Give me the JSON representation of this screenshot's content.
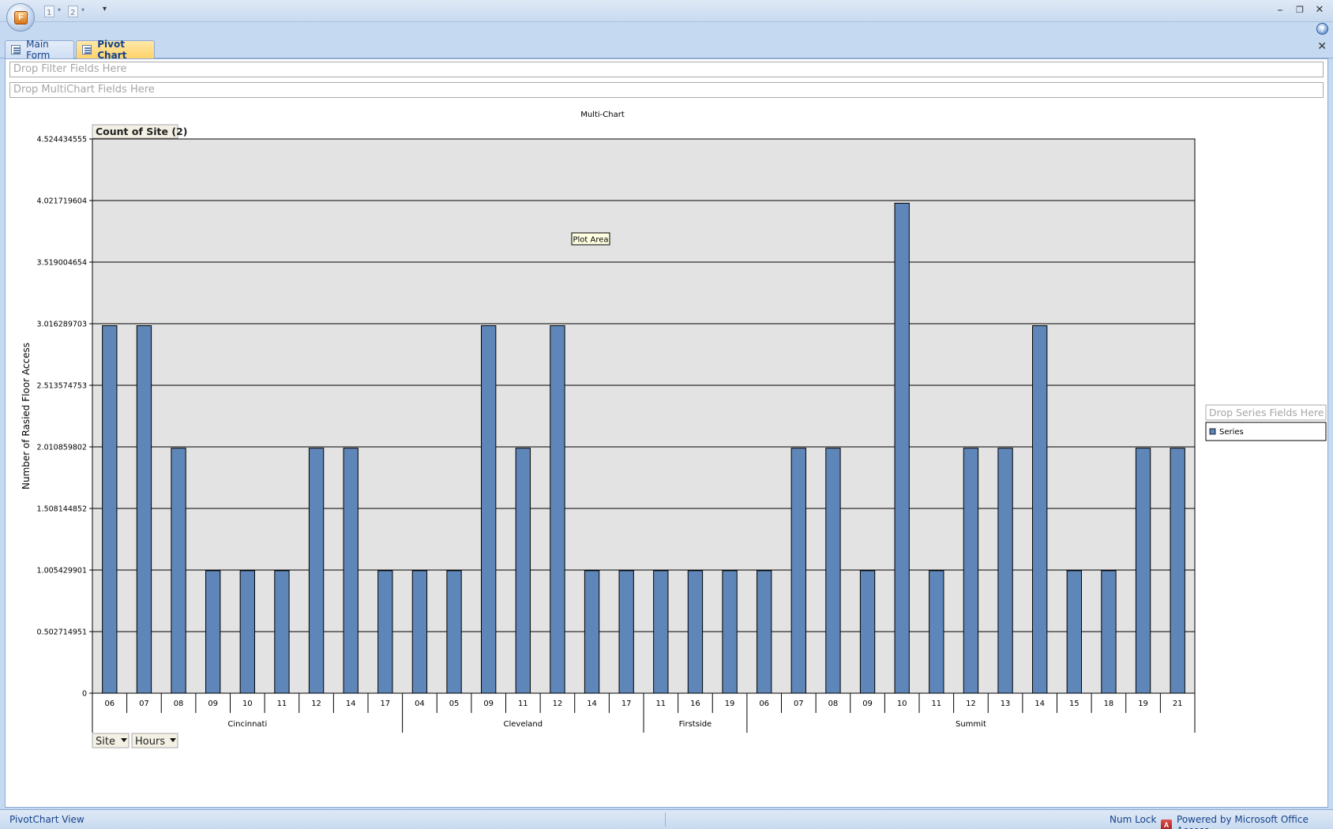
{
  "window": {
    "office_button_letter": "F",
    "qat_items": [
      "1",
      "2"
    ],
    "minimize": "–",
    "restore": "❐",
    "close": "✕",
    "help": "?"
  },
  "tabs": [
    {
      "label": "Main Form"
    },
    {
      "label": "Pivot Chart"
    }
  ],
  "doc_close": "✕",
  "dropzones": {
    "filter": "Drop Filter Fields Here",
    "multichart": "Drop MultiChart Fields Here",
    "series": "Drop Series Fields Here"
  },
  "statusbar": {
    "view": "PivotChart View",
    "num_lock": "Num Lock",
    "powered": "Powered by Microsoft Office Access"
  },
  "chart_data": {
    "type": "bar",
    "title": "Multi-Chart",
    "data_field": "Count of Site (2)",
    "ylabel": "Number of Rasied Floor Access",
    "ylim": [
      0,
      4.524434555
    ],
    "yticks": [
      "0",
      "0.502714951",
      "1.005429901",
      "1.508144852",
      "2.010859802",
      "2.513574753",
      "3.016289703",
      "3.519004654",
      "4.021719604",
      "4.524434555"
    ],
    "tooltip": "Plot Area",
    "category_fields": [
      "Site",
      "Hours"
    ],
    "legend": {
      "entry": "Series",
      "color": "#5f86b9"
    },
    "groups": [
      {
        "name": "Cincinnati",
        "categories": [
          "06",
          "07",
          "08",
          "09",
          "10",
          "11",
          "12",
          "14",
          "17"
        ],
        "values": [
          3,
          3,
          2,
          1,
          1,
          1,
          2,
          2,
          1
        ]
      },
      {
        "name": "Cleveland",
        "categories": [
          "04",
          "05",
          "09",
          "11",
          "12",
          "14",
          "17"
        ],
        "values": [
          1,
          1,
          3,
          2,
          3,
          1,
          1
        ]
      },
      {
        "name": "Firstside",
        "categories": [
          "11",
          "16",
          "19"
        ],
        "values": [
          1,
          1,
          1
        ]
      },
      {
        "name": "Summit",
        "categories": [
          "06",
          "07",
          "08",
          "09",
          "10",
          "11",
          "12",
          "13",
          "14",
          "15",
          "18",
          "19",
          "21"
        ],
        "values": [
          1,
          2,
          2,
          1,
          4,
          1,
          2,
          2,
          3,
          1,
          1,
          2,
          2
        ]
      }
    ],
    "colors": {
      "bar": "#5f86b9",
      "plot_bg": "#e3e3e3"
    }
  }
}
